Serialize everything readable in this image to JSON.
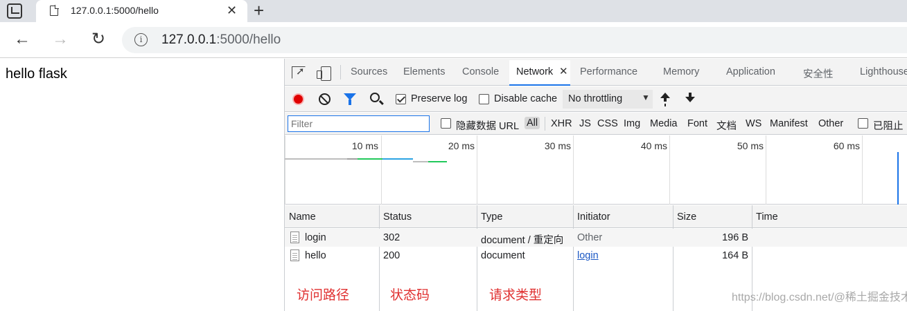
{
  "tab": {
    "title": "127.0.0.1:5000/hello"
  },
  "address": {
    "host": "127.0.0.1",
    "path": ":5000/hello"
  },
  "page": {
    "text": "hello flask"
  },
  "devtools": {
    "tabs": [
      "Sources",
      "Elements",
      "Console",
      "Network",
      "Performance",
      "Memory",
      "Application",
      "安全性",
      "Lighthouse"
    ],
    "active_tab": "Network",
    "toolbar": {
      "preserve_log": "Preserve log",
      "disable_cache": "Disable cache",
      "throttling": "No throttling"
    },
    "filter": {
      "placeholder": "Filter",
      "hide_data_urls": "隐藏数据 URL",
      "types": [
        "All",
        "XHR",
        "JS",
        "CSS",
        "Img",
        "Media",
        "Font",
        "文档",
        "WS",
        "Manifest",
        "Other"
      ],
      "blocked": "已阻止"
    },
    "timeline": {
      "labels": [
        "10 ms",
        "20 ms",
        "30 ms",
        "40 ms",
        "50 ms",
        "60 ms"
      ]
    },
    "table": {
      "headers": [
        "Name",
        "Status",
        "Type",
        "Initiator",
        "Size",
        "Time"
      ],
      "rows": [
        {
          "name": "login",
          "status": "302",
          "type": "document / 重定向",
          "initiator": "Other",
          "size": "196 B"
        },
        {
          "name": "hello",
          "status": "200",
          "type": "document",
          "initiator": "login",
          "size": "164 B"
        }
      ]
    },
    "colors": {
      "accent": "#1a73e8",
      "record": "#e00000"
    }
  },
  "annotations": [
    "访问路径",
    "状态码",
    "请求类型"
  ],
  "watermark": "https://blog.csdn.net/@稀土掘金技术社区"
}
